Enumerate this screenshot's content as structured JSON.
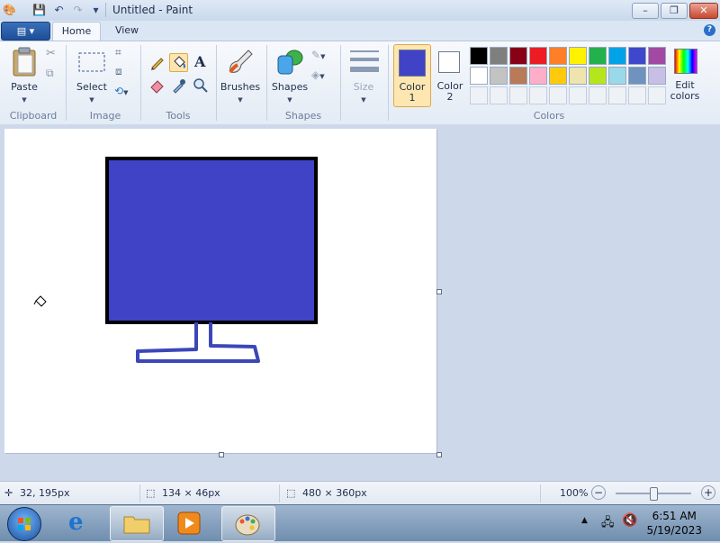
{
  "window": {
    "title": "Untitled - Paint",
    "controls": {
      "minimize": "–",
      "maximize": "❐",
      "close": "✕"
    }
  },
  "tabs": {
    "menu_label": "▤ ▾",
    "home": "Home",
    "view": "View"
  },
  "ribbon": {
    "clipboard": {
      "paste": "Paste",
      "group": "Clipboard"
    },
    "image": {
      "select": "Select",
      "group": "Image"
    },
    "tools": {
      "group": "Tools",
      "text_tool": "A"
    },
    "brushes": {
      "label": "Brushes"
    },
    "shapes": {
      "label": "Shapes",
      "group": "Shapes"
    },
    "size": {
      "label": "Size"
    },
    "colors": {
      "color1": {
        "label": "Color",
        "index": "1",
        "value": "#4043c6"
      },
      "color2": {
        "label": "Color",
        "index": "2",
        "value": "#ffffff"
      },
      "edit_colors": "Edit colors",
      "group": "Colors",
      "palette_row1": [
        "#000000",
        "#7f7f7f",
        "#880015",
        "#ed1c24",
        "#ff7f27",
        "#fff200",
        "#22b14c",
        "#00a2e8",
        "#3f48cc",
        "#a349a4"
      ],
      "palette_row2": [
        "#ffffff",
        "#c3c3c3",
        "#b97a57",
        "#ffaec9",
        "#ffc90e",
        "#efe4b0",
        "#b5e61d",
        "#99d9ea",
        "#7092be",
        "#c8bfe7"
      ]
    }
  },
  "drawing": {
    "fill_color": "#4043c6",
    "outline_color": "#000000",
    "stand_color": "#3b47b8"
  },
  "status": {
    "cursor_pos": "32, 195px",
    "selection_size": "134 × 46px",
    "image_size": "480 × 360px",
    "zoom": "100%"
  },
  "taskbar": {
    "time": "6:51 AM",
    "date": "5/19/2023"
  }
}
